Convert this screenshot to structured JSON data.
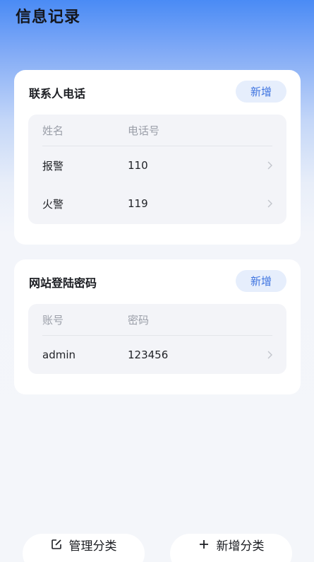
{
  "page": {
    "title": "信息记录"
  },
  "colors": {
    "accent": "#3f74e0",
    "add_button_bg": "#e6eefc"
  },
  "sections": [
    {
      "title": "联系人电话",
      "add_label": "新增",
      "columns": [
        "姓名",
        "电话号"
      ],
      "rows": [
        {
          "c1": "报警",
          "c2": "110"
        },
        {
          "c1": "火警",
          "c2": "119"
        }
      ]
    },
    {
      "title": "网站登陆密码",
      "add_label": "新增",
      "columns": [
        "账号",
        "密码"
      ],
      "rows": [
        {
          "c1": "admin",
          "c2": "123456"
        }
      ]
    }
  ],
  "bottom": {
    "manage_label": "管理分类",
    "manage_icon": "edit-icon",
    "new_label": "新增分类",
    "new_icon": "plus-icon"
  }
}
